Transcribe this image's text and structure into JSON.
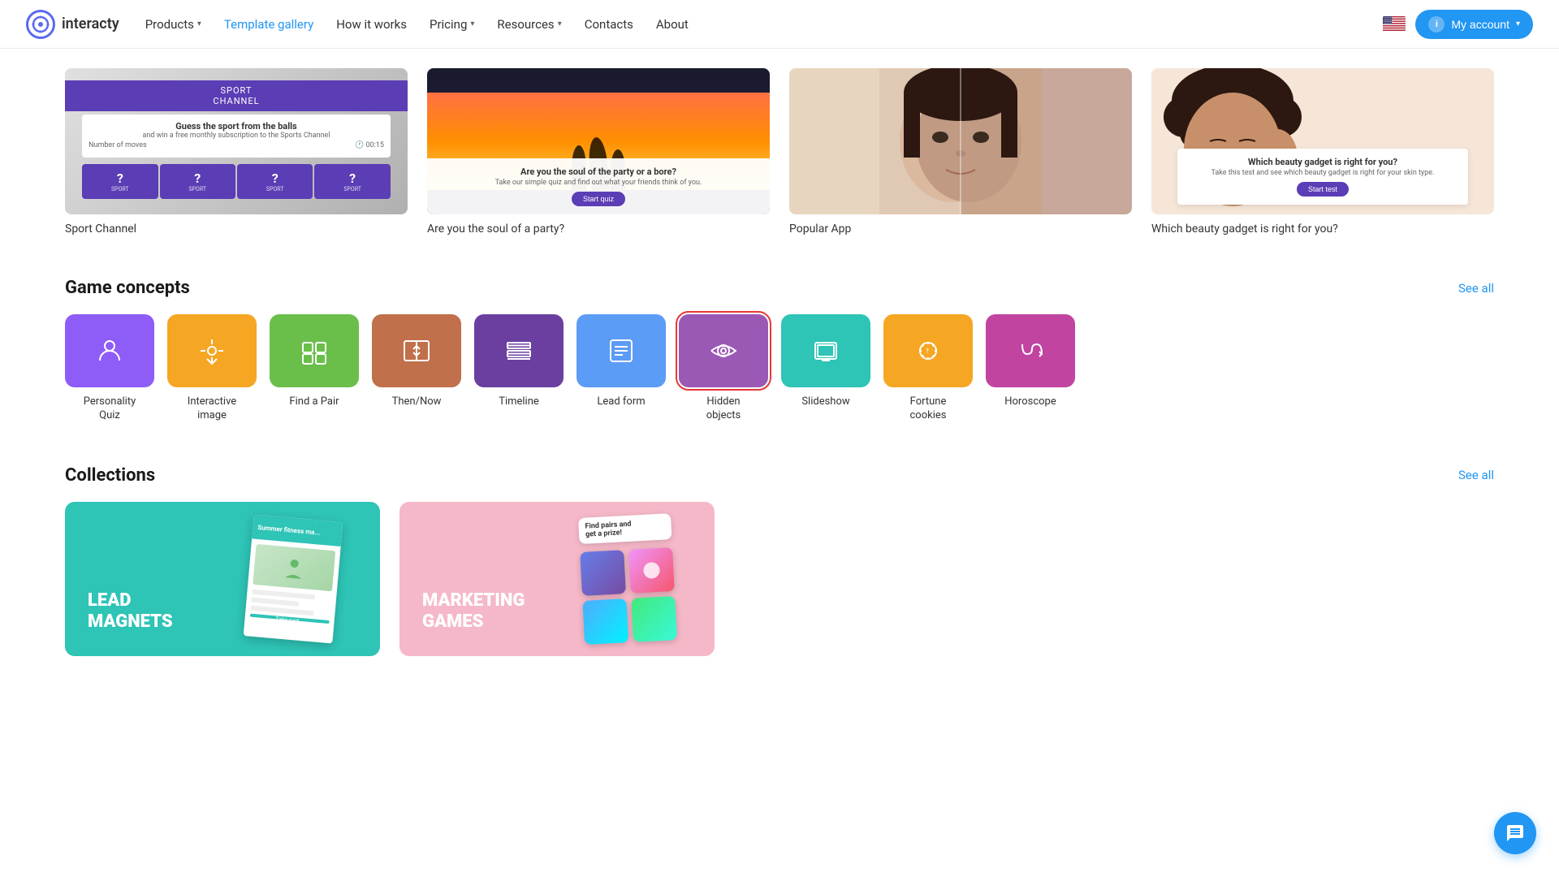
{
  "brand": {
    "logo_text": "interacty",
    "logo_icon": "◎"
  },
  "navbar": {
    "links": [
      {
        "id": "products",
        "label": "Products",
        "dropdown": true,
        "active": false
      },
      {
        "id": "template-gallery",
        "label": "Template gallery",
        "dropdown": false,
        "active": true
      },
      {
        "id": "how-it-works",
        "label": "How it works",
        "dropdown": false,
        "active": false
      },
      {
        "id": "pricing",
        "label": "Pricing",
        "dropdown": true,
        "active": false
      },
      {
        "id": "resources",
        "label": "Resources",
        "dropdown": true,
        "active": false
      },
      {
        "id": "contacts",
        "label": "Contacts",
        "dropdown": false,
        "active": false
      },
      {
        "id": "about",
        "label": "About",
        "dropdown": false,
        "active": false
      }
    ],
    "my_account": "My account"
  },
  "featured": {
    "cards": [
      {
        "id": "sport-channel",
        "title": "Sport Channel",
        "type": "sport"
      },
      {
        "id": "are-you-soul",
        "title": "Are you the soul of a party?",
        "type": "party"
      },
      {
        "id": "popular-app",
        "title": "Popular App",
        "type": "portrait"
      },
      {
        "id": "beauty-gadget",
        "title": "Which beauty gadget is right for you?",
        "type": "beauty"
      }
    ]
  },
  "sport_card": {
    "banner": "SPORT",
    "channel": "channel",
    "guess_text": "Guess the sport from the balls",
    "win_text": "and win a free monthly subscription to the Sports Channel",
    "moves_label": "Number of moves",
    "time": "00:15",
    "tiles": [
      "SPORT",
      "SPORT",
      "SPORT",
      "SPORT"
    ]
  },
  "party_card": {
    "question": "Are you the soul of the party or a bore?",
    "subtitle": "Take our simple quiz and find out what your friends think of you.",
    "btn": "Start quiz"
  },
  "beauty_card": {
    "question": "Which beauty gadget is right for you?",
    "subtitle": "Take this test and see which beauty gadget is right for your skin type.",
    "btn": "Start test"
  },
  "game_concepts": {
    "section_title": "Game concepts",
    "see_all": "See all",
    "items": [
      {
        "id": "personality-quiz",
        "label": "Personality\nQuiz",
        "bg": "bg-purple",
        "icon": "person"
      },
      {
        "id": "interactive-image",
        "label": "Interactive\nimage",
        "bg": "bg-orange",
        "icon": "pin"
      },
      {
        "id": "find-pair",
        "label": "Find a Pair",
        "bg": "bg-green",
        "icon": "pair"
      },
      {
        "id": "then-now",
        "label": "Then/Now",
        "bg": "bg-brown",
        "icon": "then-now"
      },
      {
        "id": "timeline",
        "label": "Timeline",
        "bg": "bg-dark-purple",
        "icon": "timeline"
      },
      {
        "id": "lead-form",
        "label": "Lead form",
        "bg": "bg-blue",
        "icon": "lead"
      },
      {
        "id": "hidden-objects",
        "label": "Hidden\nobjects",
        "bg": "bg-purple2",
        "icon": "hidden",
        "selected": true
      },
      {
        "id": "slideshow",
        "label": "Slideshow",
        "bg": "bg-teal",
        "icon": "slideshow"
      },
      {
        "id": "fortune-cookies",
        "label": "Fortune\ncookies",
        "bg": "bg-amber",
        "icon": "fortune"
      },
      {
        "id": "horoscope",
        "label": "Horoscope",
        "bg": "bg-magenta",
        "icon": "horoscope"
      }
    ]
  },
  "collections": {
    "section_title": "Collections",
    "see_all": "See all",
    "items": [
      {
        "id": "lead-magnets",
        "label": "LEAD\nMAGNETS",
        "type": "lead"
      },
      {
        "id": "marketing-games",
        "label": "MARKETING\nGAMES",
        "type": "marketing"
      }
    ]
  },
  "chat_btn": {
    "title": "Open chat"
  }
}
